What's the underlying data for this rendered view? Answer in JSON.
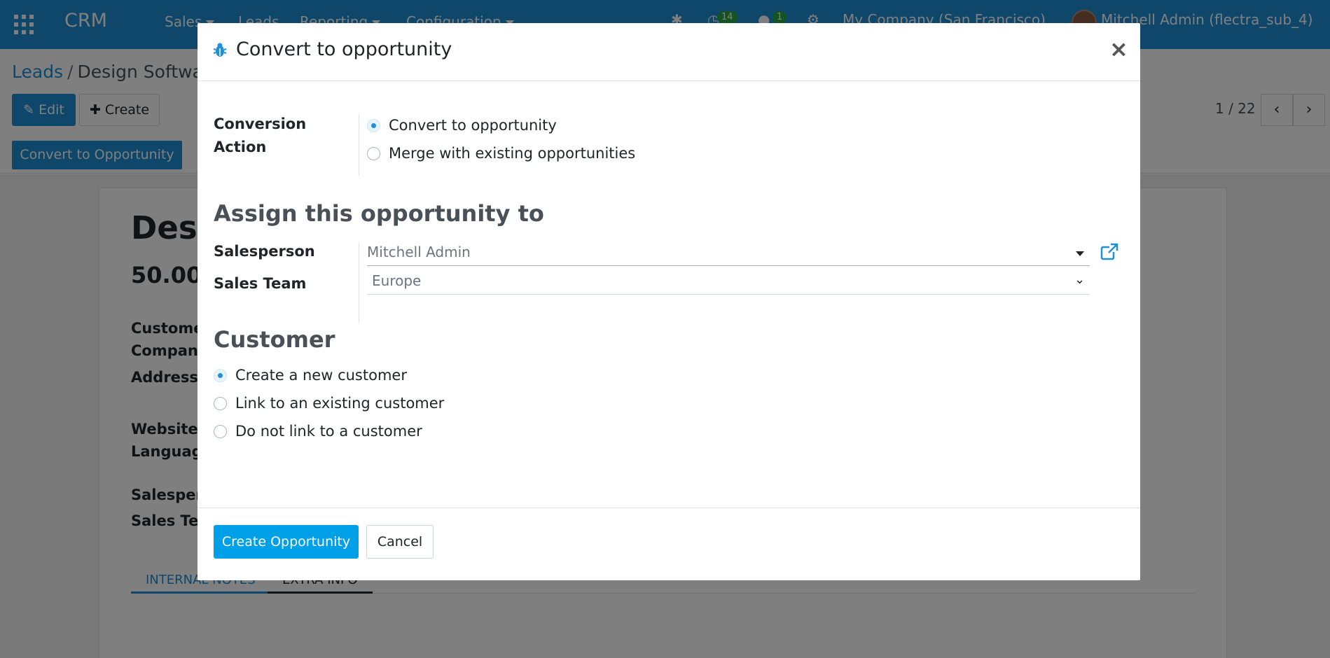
{
  "navbar": {
    "brand": "CRM",
    "menu": [
      "Sales",
      "Leads",
      "Reporting",
      "Configuration"
    ],
    "activity_count": "14",
    "message_count": "1",
    "company": "My Company (San Francisco)",
    "user": "Mitchell Admin (flectra_sub_4)"
  },
  "breadcrumb": {
    "parent": "Leads",
    "current": "Design Software"
  },
  "toolbar": {
    "edit_label": "Edit",
    "create_label": "Create",
    "pager": "1 / 22"
  },
  "statusbar": {
    "convert_label": "Convert to Opportunity"
  },
  "record": {
    "title": "Design Software",
    "amount": "50.00",
    "labels": [
      "Customer",
      "Company",
      "Address",
      "Website",
      "Language",
      "Salesperson",
      "Sales Team"
    ],
    "tabs": [
      "INTERNAL NOTES",
      "EXTRA INFO"
    ]
  },
  "modal": {
    "title": "Convert to opportunity",
    "close_symbol": "×",
    "conversion_action": {
      "label": "Conversion Action",
      "options": [
        {
          "label": "Convert to opportunity",
          "checked": true
        },
        {
          "label": "Merge with existing opportunities",
          "checked": false
        }
      ]
    },
    "assign": {
      "heading": "Assign this opportunity to",
      "salesperson_label": "Salesperson",
      "salesperson_value": "Mitchell Admin",
      "sales_team_label": "Sales Team",
      "sales_team_value": "Europe"
    },
    "customer": {
      "heading": "Customer",
      "options": [
        {
          "label": "Create a new customer",
          "checked": true
        },
        {
          "label": "Link to an existing customer",
          "checked": false
        },
        {
          "label": "Do not link to a customer",
          "checked": false
        }
      ]
    },
    "footer": {
      "primary_label": "Create Opportunity",
      "cancel_label": "Cancel"
    }
  },
  "colors": {
    "primary": "#1f8fd6",
    "button_primary": "#00a0e9",
    "backdrop": "rgba(0,0,0,0.5)"
  }
}
